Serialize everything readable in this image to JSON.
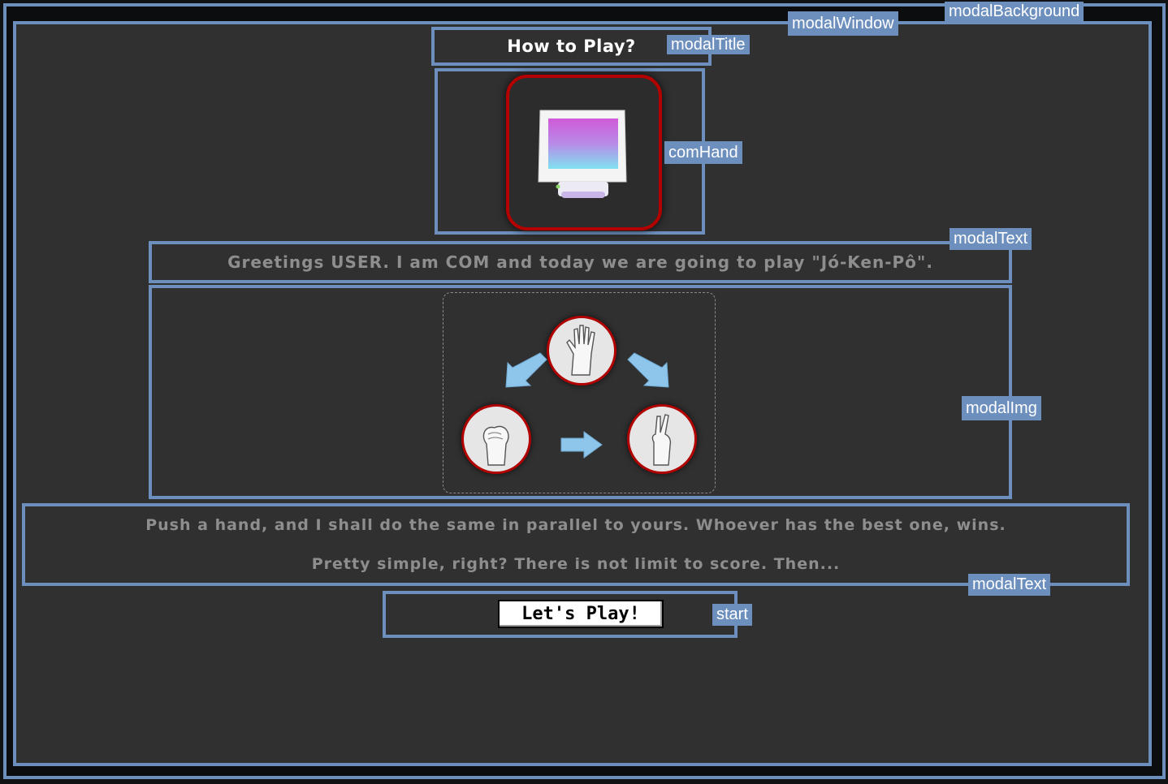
{
  "annotations": {
    "modalBackground": "modalBackground",
    "modalWindow": "modalWindow",
    "modalTitle": "modalTitle",
    "comHand": "comHand",
    "modalText": "modalText",
    "modalImg": "modalImg",
    "start": "start"
  },
  "modal": {
    "title": "How to Play?",
    "greeting": "Greetings USER. I am COM and today we are going to play \"Jó-Ken-Pô\".",
    "rules_line1": "Push a hand, and I shall do the same in parallel to yours. Whoever has the best one, wins.",
    "rules_line2": "Pretty simple, right? There is not limit to score. Then...",
    "start_label": "Let's Play!"
  },
  "colors": {
    "annotation": "#6d8fbd",
    "frame_red": "#b30000",
    "arrow": "#8ec5ea",
    "panel": "#303030"
  },
  "icons": {
    "com": "computer-monitor-icon",
    "paper": "paper-hand-icon",
    "rock": "rock-hand-icon",
    "scissors": "scissors-hand-icon",
    "arrow": "cycle-arrow-icon"
  }
}
